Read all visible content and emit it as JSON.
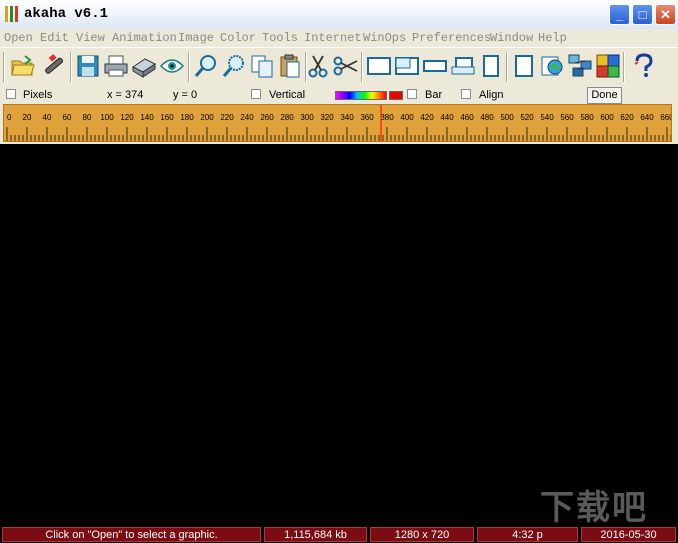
{
  "window": {
    "title": "akaha v6.1",
    "minimize_label": "_",
    "maximize_label": "□",
    "close_label": "✕"
  },
  "menu": [
    "Open",
    "Edit",
    "View",
    "Animation",
    "Image",
    "Color",
    "Tools",
    "Internet",
    "WinOps",
    "Preferences",
    "Window",
    "Help"
  ],
  "toolbar_icons": [
    "open-folder-icon",
    "wand-icon",
    "save-disk-icon",
    "print-icon",
    "scanner-icon",
    "eye-icon",
    "zoom-icon",
    "zoom-fit-icon",
    "copy-icon",
    "paste-icon",
    "cut-icon",
    "crop-icon",
    "frame-1-icon",
    "frame-2-icon",
    "frame-3-icon",
    "frame-4-icon",
    "frame-5-icon",
    "page-icon",
    "globe-icon",
    "network-icon",
    "puzzle-icon",
    "help-icon"
  ],
  "options": {
    "pixels_label": "Pixels",
    "x_readout": "x = 374",
    "y_readout": "y = 0",
    "vertical_label": "Vertical",
    "bar_label": "Bar",
    "align_label": "Align",
    "done_label": "Done"
  },
  "ruler": {
    "labels": [
      "0",
      "20",
      "40",
      "60",
      "80",
      "100",
      "120",
      "140",
      "160",
      "180",
      "200",
      "220",
      "240",
      "260",
      "280",
      "300",
      "320",
      "340",
      "360",
      "380",
      "400",
      "420",
      "440",
      "460",
      "480",
      "500",
      "520",
      "540",
      "560",
      "580",
      "600",
      "620",
      "640",
      "660"
    ],
    "marker_value": 374,
    "colors": {
      "background": "#e0a23a",
      "marker": "#ff0000"
    }
  },
  "status": {
    "message": "Click on \"Open\" to select a graphic.",
    "memory": "1,115,684 kb",
    "resolution": "1280 x 720",
    "time": "4:32 p",
    "date": "2016-05-30"
  },
  "watermark": "下载吧"
}
